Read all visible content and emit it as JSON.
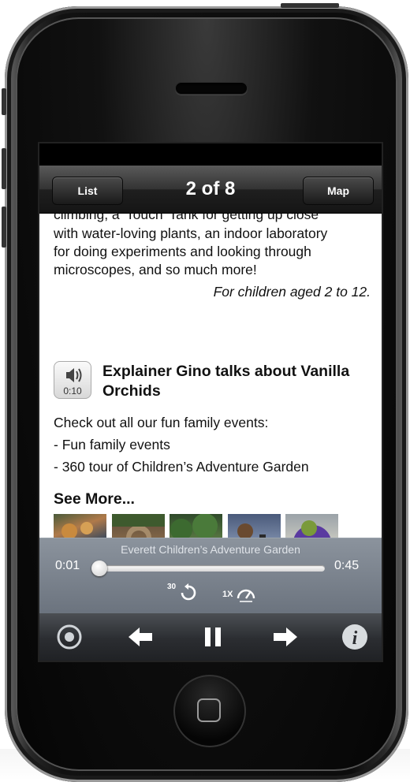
{
  "nav": {
    "left_button": "List",
    "title": "2 of 8",
    "right_button": "Map"
  },
  "content": {
    "intro_lines": [
      "climbing, a 'Touch' Tank for getting up close",
      "with water-loving plants, an indoor laboratory",
      "for doing experiments and looking through",
      "microscopes, and so much more!"
    ],
    "audience": "For children aged 2 to 12.",
    "audio": {
      "duration": "0:10",
      "title": "Explainer Gino talks about Vanilla Orchids",
      "icon": "speaker-icon"
    },
    "events_intro": "Check out all our fun family events:",
    "links": [
      "- Fun family events",
      "- 360 tour of Children’s Adventure Garden"
    ],
    "see_more": "See More...",
    "thumbnails": [
      "orchid-photo",
      "garden-arch-photo",
      "garden-plants-photo",
      "child-microscope-photo",
      "topiary-gorilla-photo"
    ]
  },
  "player": {
    "track_title": "Everett Children’s Adventure Garden",
    "elapsed": "0:01",
    "total": "0:45",
    "progress": 0.02,
    "skip_back_label": "30",
    "speed_label": "1X"
  },
  "controls": {
    "icons": [
      "target-icon",
      "previous-arrow-icon",
      "pause-icon",
      "next-arrow-icon",
      "info-icon"
    ]
  },
  "colors": {
    "progress_blue": "#2f6fd8",
    "player_bg": "#7b838d",
    "nav_bg": "#1f1f1f"
  }
}
